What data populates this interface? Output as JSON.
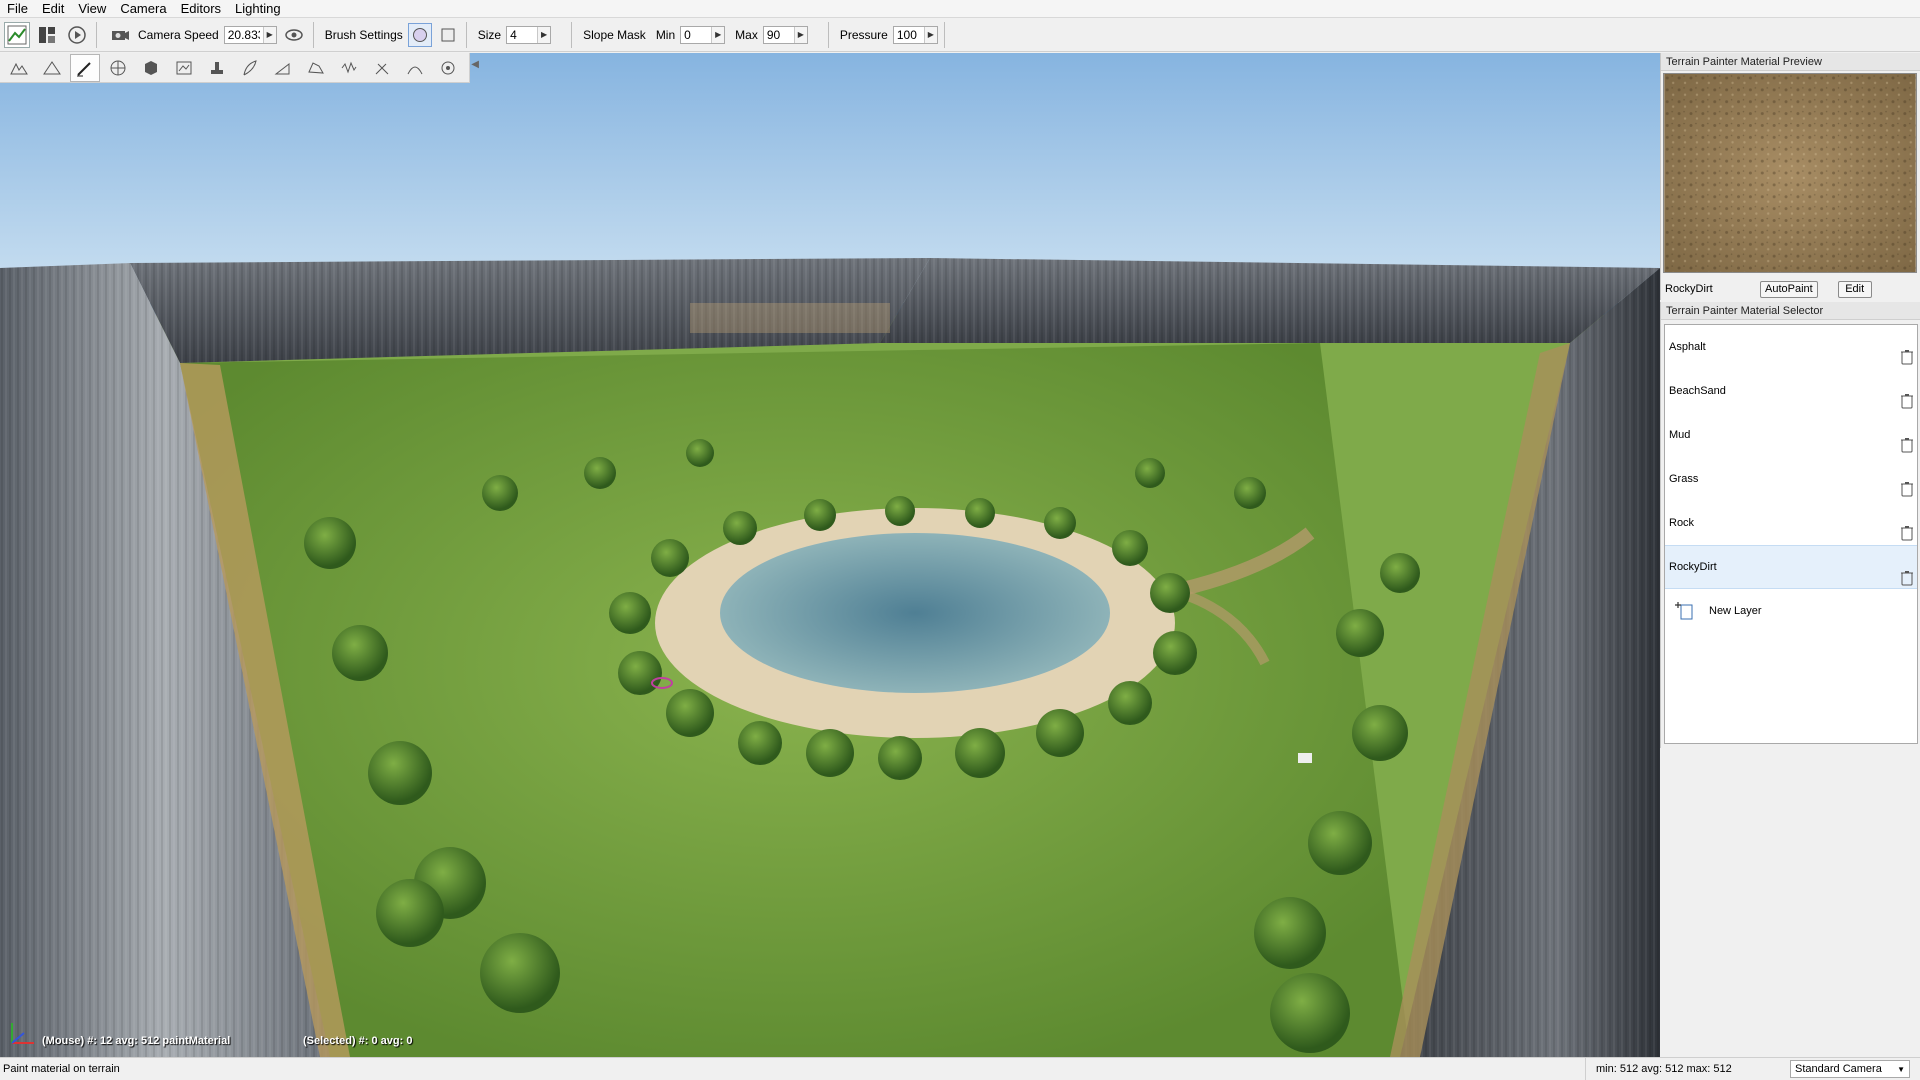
{
  "menubar": {
    "items": [
      "File",
      "Edit",
      "View",
      "Camera",
      "Editors",
      "Lighting"
    ]
  },
  "toolbar": {
    "camera_speed_label": "Camera Speed",
    "camera_speed_value": "20.833",
    "brush_settings_label": "Brush Settings",
    "size_label": "Size",
    "size_value": "4",
    "slope_mask_label": "Slope Mask",
    "min_label": "Min",
    "min_value": "0",
    "max_label": "Max",
    "max_value": "90",
    "pressure_label": "Pressure",
    "pressure_value": "100"
  },
  "viewport": {
    "mouse_info": "(Mouse) #: 12  avg: 512 paintMaterial",
    "selected_info": "(Selected) #: 0  avg: 0"
  },
  "preview_panel": {
    "title": "Terrain Painter Material Preview",
    "material_name": "RockyDirt",
    "autopaint_label": "AutoPaint",
    "edit_label": "Edit"
  },
  "selector_panel": {
    "title": "Terrain Painter Material Selector",
    "layers": [
      {
        "name": "Asphalt"
      },
      {
        "name": "BeachSand"
      },
      {
        "name": "Mud"
      },
      {
        "name": "Grass"
      },
      {
        "name": "Rock"
      },
      {
        "name": "RockyDirt"
      }
    ],
    "new_layer_label": "New Layer"
  },
  "statusbar": {
    "left_text": "Paint material on terrain",
    "stats": "min: 512  avg: 512  max: 512",
    "camera_mode": "Standard Camera"
  }
}
